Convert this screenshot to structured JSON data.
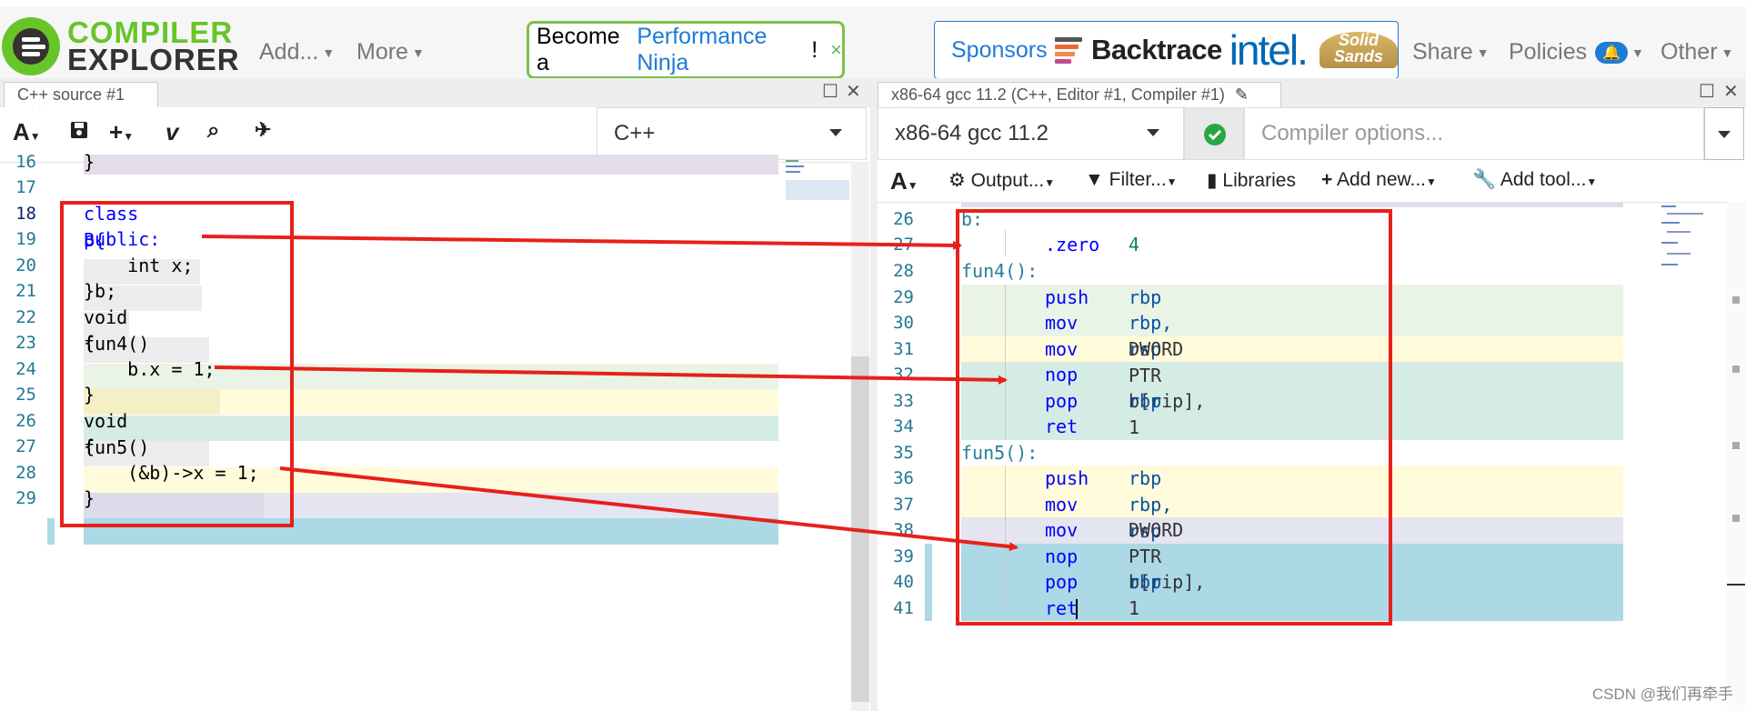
{
  "header": {
    "logo_line1": "COMPILER",
    "logo_line2": "EXPLORER",
    "nav_add": "Add...",
    "nav_more": "More",
    "ninja_prefix": "Become a",
    "ninja_link": "Performance Ninja",
    "ninja_suffix": "!",
    "ninja_close": "×",
    "sponsors_label": "Sponsors",
    "sponsor_backtrace": "Backtrace",
    "sponsor_intel": "intel.",
    "sponsor_solid": "Solid Sands",
    "nav_share": "Share",
    "nav_policies": "Policies",
    "policies_badge": "🔔",
    "nav_other": "Other"
  },
  "editor": {
    "tab_title": "C++ source #1",
    "tab_close": "×",
    "language": "C++",
    "lines": [
      {
        "n": "16",
        "text": "}"
      },
      {
        "n": "17",
        "text": ""
      },
      {
        "n": "18",
        "text": "class B{"
      },
      {
        "n": "19",
        "text": "public:"
      },
      {
        "n": "20",
        "text": "    int x;"
      },
      {
        "n": "21",
        "text": "}b;"
      },
      {
        "n": "22",
        "text": "void fun4()"
      },
      {
        "n": "23",
        "text": "{"
      },
      {
        "n": "24",
        "text": "    b.x = 1;"
      },
      {
        "n": "25",
        "text": "}"
      },
      {
        "n": "26",
        "text": "void fun5()"
      },
      {
        "n": "27",
        "text": "{"
      },
      {
        "n": "28",
        "text": "    (&b)->x = 1;"
      },
      {
        "n": "29",
        "text": "}"
      }
    ]
  },
  "compiler": {
    "tab_title": "x86-64 gcc 11.2 (C++, Editor #1, Compiler #1)",
    "tab_close": "×",
    "compiler_name": "x86-64 gcc 11.2",
    "options_placeholder": "Compiler options...",
    "toolbar": {
      "output": "Output...",
      "filter": "Filter...",
      "libraries": "Libraries",
      "add_new": "Add new...",
      "add_tool": "Add tool..."
    },
    "lines": [
      {
        "n": "26",
        "label": "b:"
      },
      {
        "n": "27",
        "ins": ".zero",
        "ops": "4"
      },
      {
        "n": "28",
        "label": "fun4():"
      },
      {
        "n": "29",
        "ins": "push",
        "ops": "rbp"
      },
      {
        "n": "30",
        "ins": "mov",
        "ops": "rbp, rsp"
      },
      {
        "n": "31",
        "ins": "mov",
        "ops": "DWORD PTR b[rip], 1"
      },
      {
        "n": "32",
        "ins": "nop",
        "ops": ""
      },
      {
        "n": "33",
        "ins": "pop",
        "ops": "rbp"
      },
      {
        "n": "34",
        "ins": "ret",
        "ops": ""
      },
      {
        "n": "35",
        "label": "fun5():"
      },
      {
        "n": "36",
        "ins": "push",
        "ops": "rbp"
      },
      {
        "n": "37",
        "ins": "mov",
        "ops": "rbp, rsp"
      },
      {
        "n": "38",
        "ins": "mov",
        "ops": "DWORD PTR b[rip], 1"
      },
      {
        "n": "39",
        "ins": "nop",
        "ops": ""
      },
      {
        "n": "40",
        "ins": "pop",
        "ops": "rbp"
      },
      {
        "n": "41",
        "ins": "ret",
        "ops": ""
      }
    ]
  },
  "watermark": "CSDN @我们再牵手",
  "colors": {
    "brand_green": "#67c52a",
    "link_blue": "#1e7bd6",
    "annotation_red": "#e8201a",
    "hl_purple": "#e5dcea",
    "hl_green": "#e9f4e6",
    "hl_yellow": "#fffbdb",
    "hl_teal": "#d5ece5",
    "hl_lavender": "#e5e4f1",
    "hl_blue": "#add8e6"
  }
}
